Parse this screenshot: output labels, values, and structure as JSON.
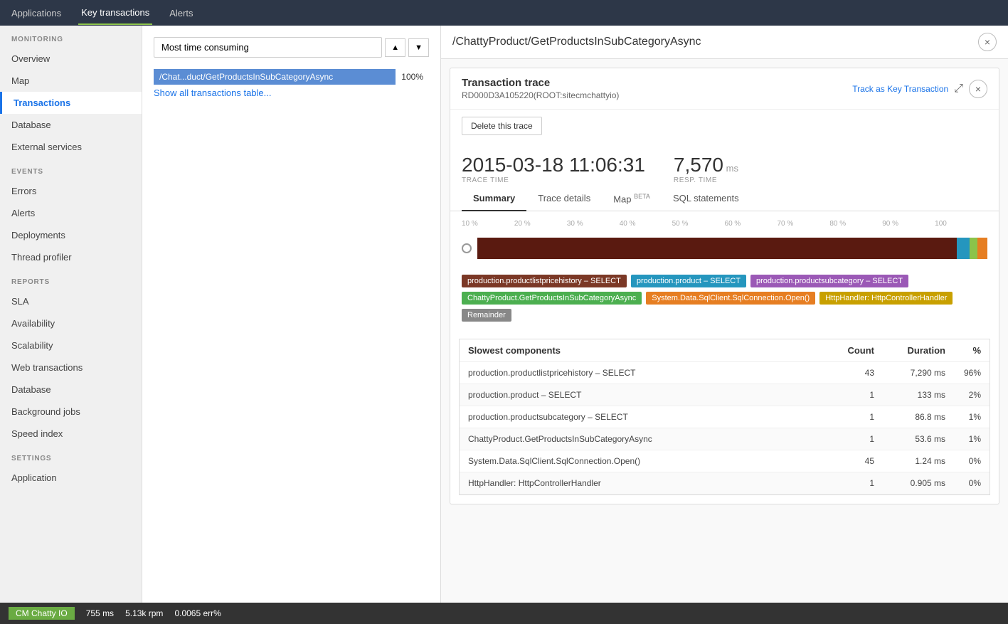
{
  "topNav": {
    "items": [
      {
        "label": "Applications",
        "active": false
      },
      {
        "label": "Key transactions",
        "active": true
      },
      {
        "label": "Alerts",
        "active": false
      }
    ]
  },
  "sidebar": {
    "monitoring_label": "MONITORING",
    "monitoring_items": [
      {
        "label": "Overview",
        "active": false
      },
      {
        "label": "Map",
        "active": false
      },
      {
        "label": "Transactions",
        "active": true
      },
      {
        "label": "Database",
        "active": false
      },
      {
        "label": "External services",
        "active": false
      }
    ],
    "events_label": "EVENTS",
    "events_items": [
      {
        "label": "Errors",
        "active": false
      },
      {
        "label": "Alerts",
        "active": false
      },
      {
        "label": "Deployments",
        "active": false
      },
      {
        "label": "Thread profiler",
        "active": false
      }
    ],
    "reports_label": "REPORTS",
    "reports_items": [
      {
        "label": "SLA",
        "active": false
      },
      {
        "label": "Availability",
        "active": false
      },
      {
        "label": "Scalability",
        "active": false
      },
      {
        "label": "Web transactions",
        "active": false
      },
      {
        "label": "Database",
        "active": false
      },
      {
        "label": "Background jobs",
        "active": false
      },
      {
        "label": "Speed index",
        "active": false
      }
    ],
    "settings_label": "SETTINGS",
    "settings_items": [
      {
        "label": "Application",
        "active": false
      }
    ]
  },
  "filterDropdown": {
    "value": "Most time consuming",
    "placeholder": "Most time consuming"
  },
  "transactionBar": {
    "label": "/Chat...duct/GetProductsInSubCategoryAsync",
    "percentage": "100%"
  },
  "showAllLink": "Show all transactions table...",
  "detailHeader": {
    "title": "/ChattyProduct/GetProductsInSubCategoryAsync",
    "closeBtn": "×"
  },
  "traceCard": {
    "title": "Transaction trace",
    "subtitle": "RD000D3A105220(ROOT:sitecmchattyio)",
    "trackKeyLabel": "Track as Key Transaction",
    "deleteLabel": "Delete this trace",
    "traceTime": {
      "value": "2015-03-18 11:06:31",
      "label": "TRACE TIME"
    },
    "respTime": {
      "value": "7,570",
      "unit": "ms",
      "label": "RESP. TIME"
    },
    "tabs": [
      {
        "label": "Summary",
        "active": true
      },
      {
        "label": "Trace details",
        "active": false
      },
      {
        "label": "Map",
        "active": false,
        "badge": "BETA"
      },
      {
        "label": "SQL statements",
        "active": false
      }
    ]
  },
  "barChart": {
    "scaleLabels": [
      "10 %",
      "20 %",
      "30 %",
      "40 %",
      "50 %",
      "60 %",
      "70 %",
      "80 %",
      "90 %",
      "100"
    ],
    "segments": [
      {
        "color": "#5a1a10",
        "width": 96
      },
      {
        "color": "#2596be",
        "width": 2
      },
      {
        "color": "#8bc34a",
        "width": 1
      },
      {
        "color": "#e67e22",
        "width": 1
      }
    ]
  },
  "legend": [
    {
      "label": "production.productlistpricehistory – SELECT",
      "color": "#7b3826"
    },
    {
      "label": "production.product – SELECT",
      "color": "#2596be"
    },
    {
      "label": "production.productsubcategory – SELECT",
      "color": "#9b59b6"
    },
    {
      "label": "ChattyProduct.GetProductsInSubCategoryAsync",
      "color": "#4caf50"
    },
    {
      "label": "System.Data.SqlClient.SqlConnection.Open()",
      "color": "#e67e22"
    },
    {
      "label": "HttpHandler: HttpControllerHandler",
      "color": "#c8a000"
    },
    {
      "label": "Remainder",
      "color": "#888"
    }
  ],
  "slowestComponents": {
    "title": "Slowest components",
    "headers": {
      "name": "",
      "count": "Count",
      "duration": "Duration",
      "pct": "%"
    },
    "rows": [
      {
        "name": "production.productlistpricehistory – SELECT",
        "count": "43",
        "duration": "7,290 ms",
        "pct": "96%"
      },
      {
        "name": "production.product – SELECT",
        "count": "1",
        "duration": "133 ms",
        "pct": "2%"
      },
      {
        "name": "production.productsubcategory – SELECT",
        "count": "1",
        "duration": "86.8 ms",
        "pct": "1%"
      },
      {
        "name": "ChattyProduct.GetProductsInSubCategoryAsync",
        "count": "1",
        "duration": "53.6 ms",
        "pct": "1%"
      },
      {
        "name": "System.Data.SqlClient.SqlConnection.Open()",
        "count": "45",
        "duration": "1.24 ms",
        "pct": "0%"
      },
      {
        "name": "HttpHandler: HttpControllerHandler",
        "count": "1",
        "duration": "0.905 ms",
        "pct": "0%"
      }
    ]
  },
  "statusBar": {
    "appName": "CM Chatty IO",
    "metrics": [
      {
        "value": "755",
        "unit": "ms",
        "label": ""
      },
      {
        "value": "5.13k",
        "unit": "rpm",
        "label": ""
      },
      {
        "value": "0.0065",
        "unit": "err%",
        "label": ""
      }
    ]
  }
}
